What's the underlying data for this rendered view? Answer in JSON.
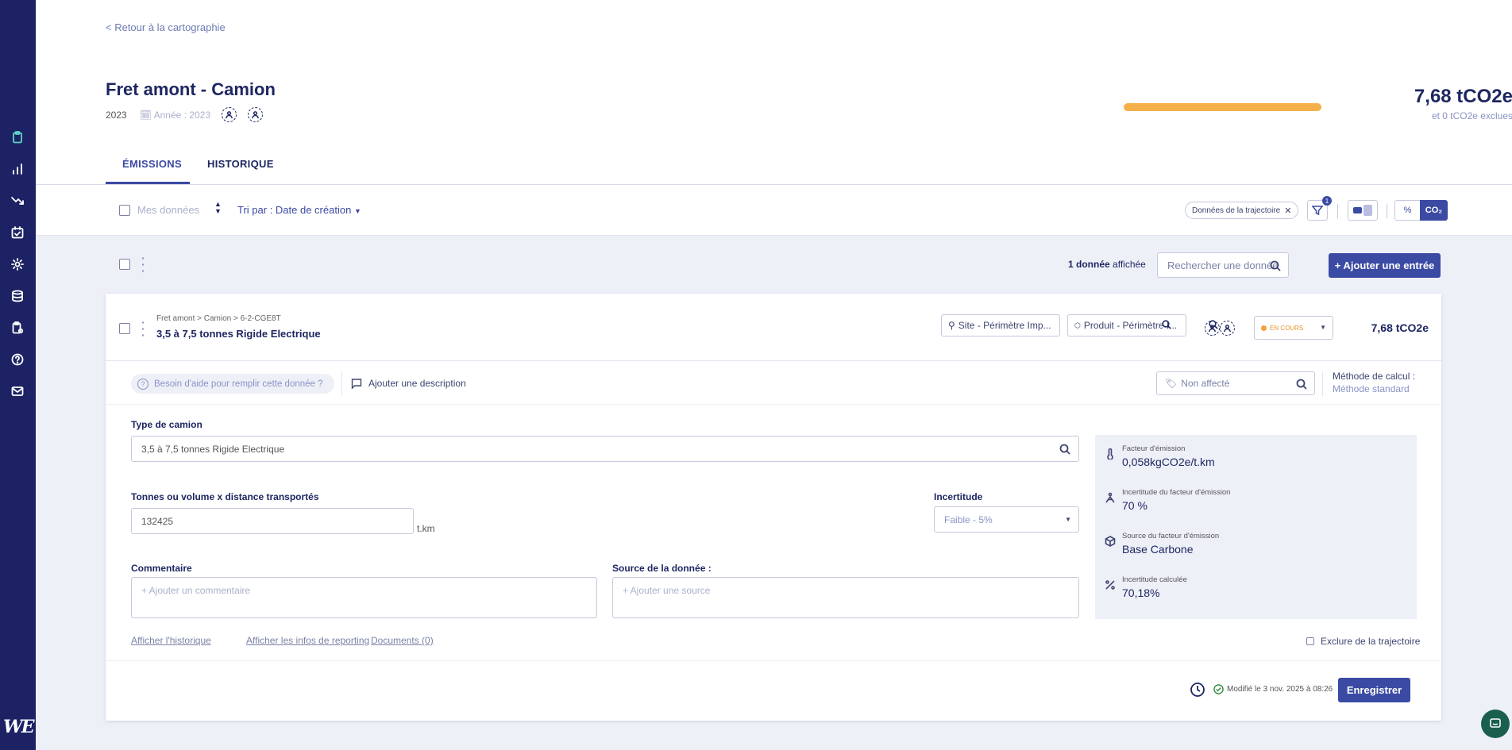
{
  "logo": "WE",
  "sidebar": {
    "items": [
      {
        "icon": "clipboard-icon",
        "active": true
      },
      {
        "icon": "bar-chart-icon"
      },
      {
        "icon": "trending-down-icon"
      },
      {
        "icon": "calendar-check-icon"
      },
      {
        "icon": "gear-icon"
      },
      {
        "icon": "database-icon"
      },
      {
        "icon": "clipboard-settings-icon"
      },
      {
        "icon": "help-circle-icon"
      },
      {
        "icon": "mail-icon"
      }
    ]
  },
  "header": {
    "back_link": "<  Retour à la cartographie",
    "title": "Fret amont - Camion",
    "year": "2023",
    "year_label": "🗓 Année : 2023",
    "progress": 1.0,
    "total": "7,68 tCO2e",
    "excluded": "et 0 tCO2e exclues"
  },
  "tabs": [
    {
      "label": "ÉMISSIONS",
      "active": true
    },
    {
      "label": "HISTORIQUE",
      "active": false
    }
  ],
  "toolbar": {
    "my_data": "Mes données",
    "sort": "Tri par : Date de création",
    "filter_chip": "Données de la trajectoire",
    "filter_count": "1",
    "unit_percent": "%",
    "unit_co2": "CO₂"
  },
  "list": {
    "count_bold": "1 donnée",
    "count_rest": " affichée",
    "search_placeholder": "Rechercher une donnée",
    "add_button": "+ Ajouter une entrée"
  },
  "entry": {
    "breadcrumb": "Fret amont > Camion > 6-2-CGE8T",
    "title": "3,5 à 7,5 tonnes Rigide Electrique",
    "site": "Site - Périmètre Imp...",
    "product": "Produit - Périmètre I...",
    "status": "EN COURS",
    "value": "7,68 tCO2e",
    "help": "Besoin d'aide pour remplir cette donnée ?",
    "add_description": "Ajouter une description",
    "tag": "Non affecté",
    "method_label": "Méthode de calcul :",
    "method_value": "Méthode standard",
    "truck_type_label": "Type de camion",
    "truck_type_value": "3,5 à 7,5 tonnes Rigide Electrique",
    "tonnage_label": "Tonnes ou volume x distance transportés",
    "tonnage_value": "132425",
    "tonnage_unit": "t.km",
    "uncertainty_label": "Incertitude",
    "uncertainty_value": "Faible - 5%",
    "comment_label": "Commentaire",
    "comment_placeholder": "+ Ajouter un commentaire",
    "source_label": "Source de la donnée :",
    "source_placeholder": "+ Ajouter une source",
    "info": [
      {
        "icon": "thermometer-icon",
        "key": "Facteur d'émission",
        "value": "0,058kgCO2e/t.km"
      },
      {
        "icon": "uncertainty-icon",
        "key": "Incertitude du facteur d'émission",
        "value": "70 %"
      },
      {
        "icon": "cube-icon",
        "key": "Source du facteur d'émission",
        "value": "Base Carbone"
      },
      {
        "icon": "percent-icon",
        "key": "Incertitude calculée",
        "value": "70,18%"
      }
    ],
    "links": [
      "Afficher l'historique",
      "Afficher les infos de reporting",
      "Documents (0)"
    ],
    "exclude": "Exclure de la trajectoire",
    "modified": "Modifié le 3 nov. 2025 à 08:26",
    "save": "Enregistrer"
  }
}
